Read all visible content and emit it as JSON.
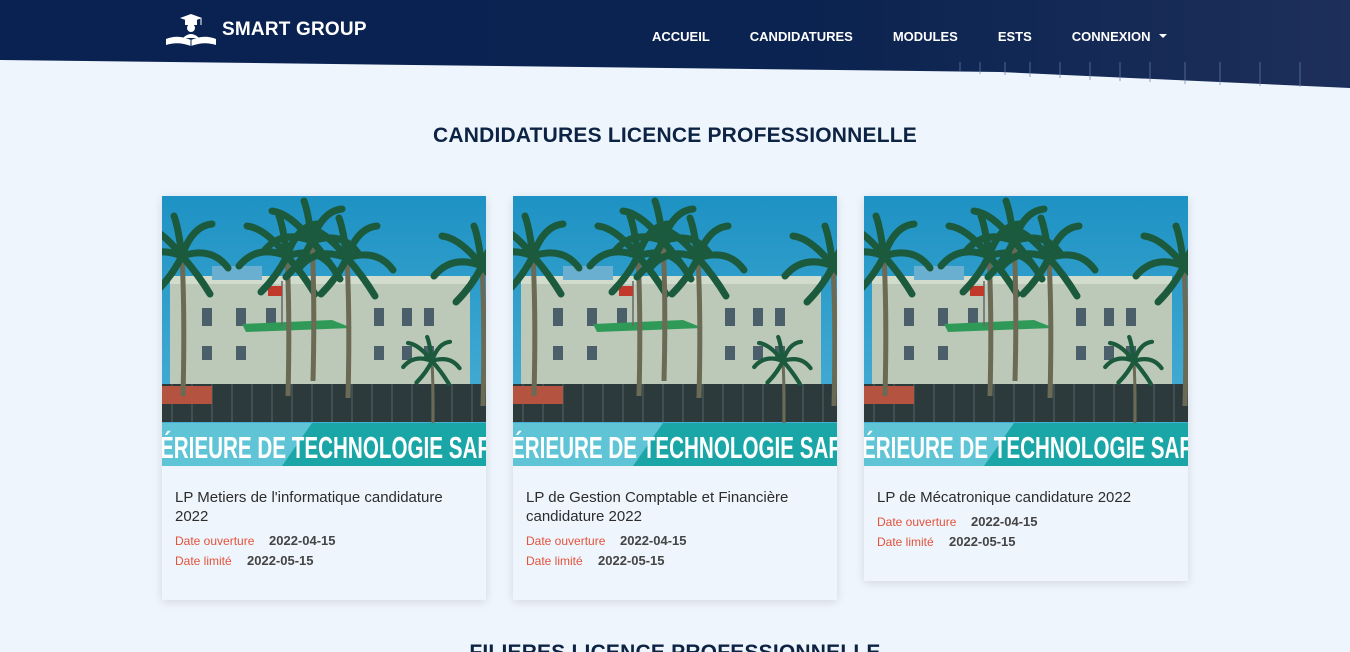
{
  "brand": {
    "name": "SMART GROUP"
  },
  "nav": {
    "items": [
      {
        "label": "ACCUEIL"
      },
      {
        "label": "CANDIDATURES"
      },
      {
        "label": "MODULES"
      },
      {
        "label": "ESTS"
      },
      {
        "label": "CONNEXION"
      }
    ]
  },
  "sections": {
    "candidatures_title": "CANDIDATURES LICENCE PROFESSIONNELLE",
    "filieres_title": "FILIERES LICENCE PROFESSIONNELLE"
  },
  "cards": [
    {
      "banner_text": "ÉRIEURE DE TECHNOLOGIE SAF",
      "title": "LP Metiers de l'informatique candidature 2022",
      "open_label": "Date ouverture",
      "open_date": "2022-04-15",
      "limit_label": "Date limité",
      "limit_date": "2022-05-15"
    },
    {
      "banner_text": "ÉRIEURE DE TECHNOLOGIE SAF",
      "title": "LP de Gestion Comptable et Financière candidature 2022",
      "open_label": "Date ouverture",
      "open_date": "2022-04-15",
      "limit_label": "Date limité",
      "limit_date": "2022-05-15"
    },
    {
      "banner_text": "ÉRIEURE DE TECHNOLOGIE SAF",
      "title": "LP de Mécatronique candidature 2022",
      "open_label": "Date ouverture",
      "open_date": "2022-04-15",
      "limit_label": "Date limité",
      "limit_date": "2022-05-15"
    }
  ],
  "colors": {
    "header_bg": "#0b2350",
    "page_bg": "#eff5fd",
    "title": "#0d2344",
    "date_label": "#e2533a",
    "banner_teal": "#1aa6a6"
  }
}
